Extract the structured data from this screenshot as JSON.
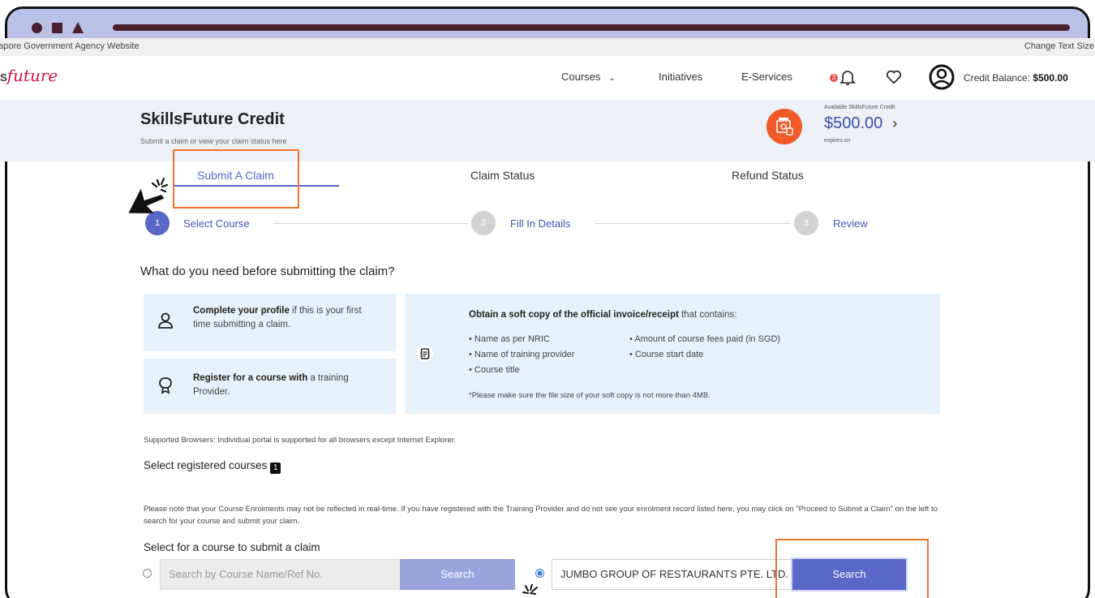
{
  "gov_bar": {
    "left": "gapore Government Agency Website",
    "right": "Change Text Size:"
  },
  "brand": {
    "prefix": "LS",
    "script": "future"
  },
  "nav": {
    "links": [
      "Courses",
      "Initiatives",
      "E-Services"
    ],
    "notification_count": "3",
    "credit_label": "Credit Balance: ",
    "credit_value": "$500.00"
  },
  "hero": {
    "title": "SkillsFuture Credit",
    "subtitle": "Submit a claim or view your claim status here",
    "available_label": "Available SkillsFuture Credit",
    "amount": "$500.00",
    "expires": "expires on"
  },
  "tabs": [
    "Submit A Claim",
    "Claim Status",
    "Refund Status"
  ],
  "steps": [
    {
      "num": "1",
      "label": "Select Course"
    },
    {
      "num": "2",
      "label": "Fill In Details"
    },
    {
      "num": "3",
      "label": "Review"
    }
  ],
  "requirements": {
    "heading": "What do you need before submitting the claim?",
    "profile": {
      "bold": "Complete your profile",
      "rest": " if this is your first time submitting a claim."
    },
    "register": {
      "bold": "Register for a course with",
      "rest": " a training Provider."
    },
    "invoice": {
      "bold": "Obtain a soft copy of the official invoice/receipt",
      "rest": " that contains:",
      "col1": [
        "Name as per NRIC",
        "Name of training provider",
        "Course title"
      ],
      "col2": [
        "Amount of course fees paid (in SGD)",
        "Course start date"
      ],
      "note": "*Please make sure the file size of your soft copy is not more than 4MB."
    }
  },
  "supported": "Supported Browsers: Individual portal is supported for all browsers except Internet Explorer.",
  "registered_heading": "Select registered courses",
  "registered_badge": "1",
  "notice": "Please note that your Course Enrolments may not be reflected in real-time. If you have registered with the Training Provider and do not see your enrolment record listed here, you may click on \"Proceed to Submit a Claim\" on the left to search for your course and submit your claim.",
  "select_heading": "Select for a course to submit a claim",
  "search": {
    "placeholder": "Search by Course Name/Ref No.",
    "button": "Search",
    "provider_value": "JUMBO GROUP OF RESTAURANTS PTE. LTD.",
    "provider_button": "Search"
  },
  "colors": {
    "accent": "#5a68c8",
    "highlight": "#f0732c",
    "card": "#e6f1fb",
    "brand": "#d6123d"
  }
}
